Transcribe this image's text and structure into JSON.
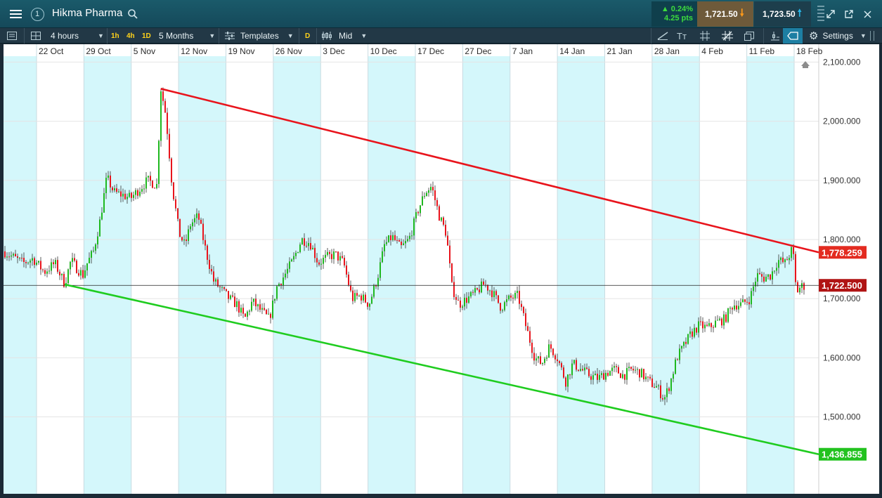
{
  "header": {
    "instrument": "Hikma Pharma",
    "badge": "1",
    "change_pct": "0.24%",
    "change_pts": "4.25 pts",
    "sell": "1,721.50",
    "buy": "1,723.50"
  },
  "toolbar": {
    "interval": "4 hours",
    "tf_1h": "1h",
    "tf_4h": "4h",
    "tf_1d": "1D",
    "range": "5 Months",
    "templates": "Templates",
    "d_label": "D",
    "price_type": "Mid",
    "settings": "Settings"
  },
  "colors": {
    "resistance": "#e8141c",
    "support": "#1fcc1f",
    "up_candle": "#1fb81f",
    "down_candle": "#e8141c",
    "shade": "#d4f7fb"
  },
  "chart_data": {
    "type": "candlestick",
    "instrument": "Hikma Pharma",
    "x_labels": [
      "22 Oct",
      "29 Oct",
      "5 Nov",
      "12 Nov",
      "19 Nov",
      "26 Nov",
      "3 Dec",
      "10 Dec",
      "17 Dec",
      "27 Dec",
      "7 Jan",
      "14 Jan",
      "21 Jan",
      "28 Jan",
      "4 Feb",
      "11 Feb",
      "18 Feb"
    ],
    "y_ticks": [
      "2,100.000",
      "2,000.000",
      "1,900.000",
      "1,800.000",
      "1,700.000",
      "1,600.000",
      "1,500.000"
    ],
    "y_tick_values": [
      2100,
      2000,
      1900,
      1800,
      1700,
      1600,
      1500
    ],
    "ylim": [
      1370,
      2110
    ],
    "price_line": {
      "label": "1,722.500",
      "value": 1722.5
    },
    "resistance_line": {
      "label": "1,778.259",
      "value": 1778.259,
      "from": {
        "x": "6 Nov",
        "y": 2055
      },
      "to": {
        "x": "18 Feb",
        "y": 1778.259
      }
    },
    "support_line": {
      "label": "1,436.855",
      "value": 1436.855,
      "from": {
        "x": "22 Oct",
        "y": 1724
      },
      "to": {
        "x": "18 Feb",
        "y": 1436.855
      }
    },
    "path": [
      [
        0,
        1780
      ],
      [
        14,
        1770
      ],
      [
        28,
        1760
      ],
      [
        42,
        1768
      ],
      [
        58,
        1745
      ],
      [
        73,
        1760
      ],
      [
        87,
        1725
      ],
      [
        96,
        1765
      ],
      [
        104,
        1752
      ],
      [
        113,
        1740
      ],
      [
        119,
        1760
      ],
      [
        128,
        1780
      ],
      [
        137,
        1830
      ],
      [
        147,
        1905
      ],
      [
        157,
        1880
      ],
      [
        170,
        1875
      ],
      [
        181,
        1870
      ],
      [
        193,
        1885
      ],
      [
        205,
        1900
      ],
      [
        218,
        1892
      ],
      [
        224,
        2055
      ],
      [
        231,
        2010
      ],
      [
        240,
        1890
      ],
      [
        250,
        1810
      ],
      [
        258,
        1790
      ],
      [
        266,
        1825
      ],
      [
        277,
        1840
      ],
      [
        288,
        1780
      ],
      [
        299,
        1730
      ],
      [
        310,
        1715
      ],
      [
        321,
        1700
      ],
      [
        332,
        1690
      ],
      [
        343,
        1665
      ],
      [
        354,
        1695
      ],
      [
        366,
        1680
      ],
      [
        378,
        1665
      ],
      [
        389,
        1720
      ],
      [
        400,
        1740
      ],
      [
        412,
        1765
      ],
      [
        424,
        1800
      ],
      [
        436,
        1795
      ],
      [
        448,
        1760
      ],
      [
        460,
        1770
      ],
      [
        472,
        1775
      ],
      [
        484,
        1760
      ],
      [
        496,
        1700
      ],
      [
        508,
        1705
      ],
      [
        520,
        1690
      ],
      [
        532,
        1735
      ],
      [
        542,
        1790
      ],
      [
        553,
        1805
      ],
      [
        565,
        1785
      ],
      [
        577,
        1800
      ],
      [
        590,
        1850
      ],
      [
        600,
        1880
      ],
      [
        609,
        1890
      ],
      [
        620,
        1840
      ],
      [
        630,
        1810
      ],
      [
        638,
        1720
      ],
      [
        648,
        1690
      ],
      [
        660,
        1700
      ],
      [
        672,
        1710
      ],
      [
        684,
        1725
      ],
      [
        696,
        1710
      ],
      [
        708,
        1685
      ],
      [
        720,
        1700
      ],
      [
        732,
        1705
      ],
      [
        744,
        1650
      ],
      [
        756,
        1600
      ],
      [
        766,
        1590
      ],
      [
        777,
        1620
      ],
      [
        788,
        1600
      ],
      [
        800,
        1560
      ],
      [
        810,
        1590
      ],
      [
        822,
        1580
      ],
      [
        834,
        1570
      ],
      [
        846,
        1565
      ],
      [
        858,
        1575
      ],
      [
        870,
        1580
      ],
      [
        882,
        1570
      ],
      [
        894,
        1580
      ],
      [
        906,
        1575
      ],
      [
        918,
        1560
      ],
      [
        930,
        1550
      ],
      [
        940,
        1530
      ],
      [
        948,
        1555
      ],
      [
        958,
        1600
      ],
      [
        968,
        1620
      ],
      [
        978,
        1640
      ],
      [
        990,
        1655
      ],
      [
        1002,
        1650
      ],
      [
        1014,
        1660
      ],
      [
        1026,
        1665
      ],
      [
        1038,
        1690
      ],
      [
        1050,
        1690
      ],
      [
        1062,
        1700
      ],
      [
        1072,
        1740
      ],
      [
        1082,
        1735
      ],
      [
        1092,
        1740
      ],
      [
        1102,
        1765
      ],
      [
        1112,
        1760
      ],
      [
        1123,
        1785
      ],
      [
        1128,
        1710
      ],
      [
        1134,
        1720
      ],
      [
        1140,
        1722
      ]
    ]
  }
}
